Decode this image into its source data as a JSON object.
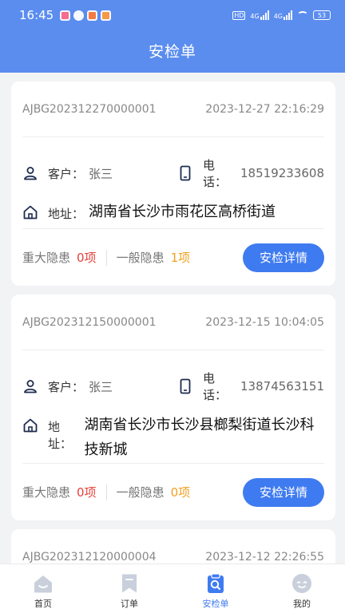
{
  "status_bar": {
    "time": "16:45",
    "network1": "4G",
    "network2": "4G",
    "battery": "53"
  },
  "header": {
    "title": "安检单"
  },
  "labels": {
    "customer": "客户：",
    "phone": "电话：",
    "address": "地址：",
    "major_hazard": "重大隐患",
    "general_hazard": "一般隐患",
    "detail_button": "安检详情"
  },
  "cards": [
    {
      "code": "AJBG202312270000001",
      "datetime": "2023-12-27 22:16:29",
      "customer": "张三",
      "phone": "18519233608",
      "address": "湖南省长沙市雨花区高桥街道",
      "major_count": "0项",
      "general_count": "1项"
    },
    {
      "code": "AJBG202312150000001",
      "datetime": "2023-12-15 10:04:05",
      "customer": "张三",
      "phone": "13874563151",
      "address": "湖南省长沙市长沙县榔梨街道长沙科技新城",
      "major_count": "0项",
      "general_count": "0项"
    },
    {
      "code": "AJBG202312120000004",
      "datetime": "2023-12-12 22:26:55"
    }
  ],
  "tabs": [
    {
      "label": "首页",
      "icon": "home-icon"
    },
    {
      "label": "订单",
      "icon": "bookmark-icon"
    },
    {
      "label": "安检单",
      "icon": "inspection-icon",
      "active": true
    },
    {
      "label": "我的",
      "icon": "profile-icon"
    }
  ],
  "colors": {
    "brand": "#5b8def",
    "button": "#3f7bf0",
    "major": "#e8413c",
    "general": "#f0a020"
  }
}
